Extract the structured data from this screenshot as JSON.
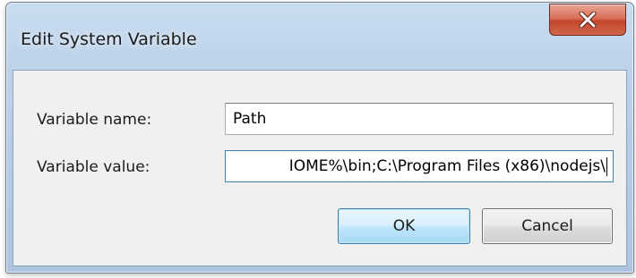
{
  "window": {
    "title": "Edit System Variable",
    "close_icon": "close-x-icon"
  },
  "form": {
    "name_label": "Variable name:",
    "name_value": "Path",
    "value_label": "Variable value:",
    "value_visible_text": "IOME%\\bin;C:\\Program Files (x86)\\nodejs\\"
  },
  "buttons": {
    "ok_label": "OK",
    "cancel_label": "Cancel"
  },
  "colors": {
    "close_button": "#c4452c",
    "focus_border": "#3c7fb1",
    "client_background": "#f0f0f0"
  }
}
